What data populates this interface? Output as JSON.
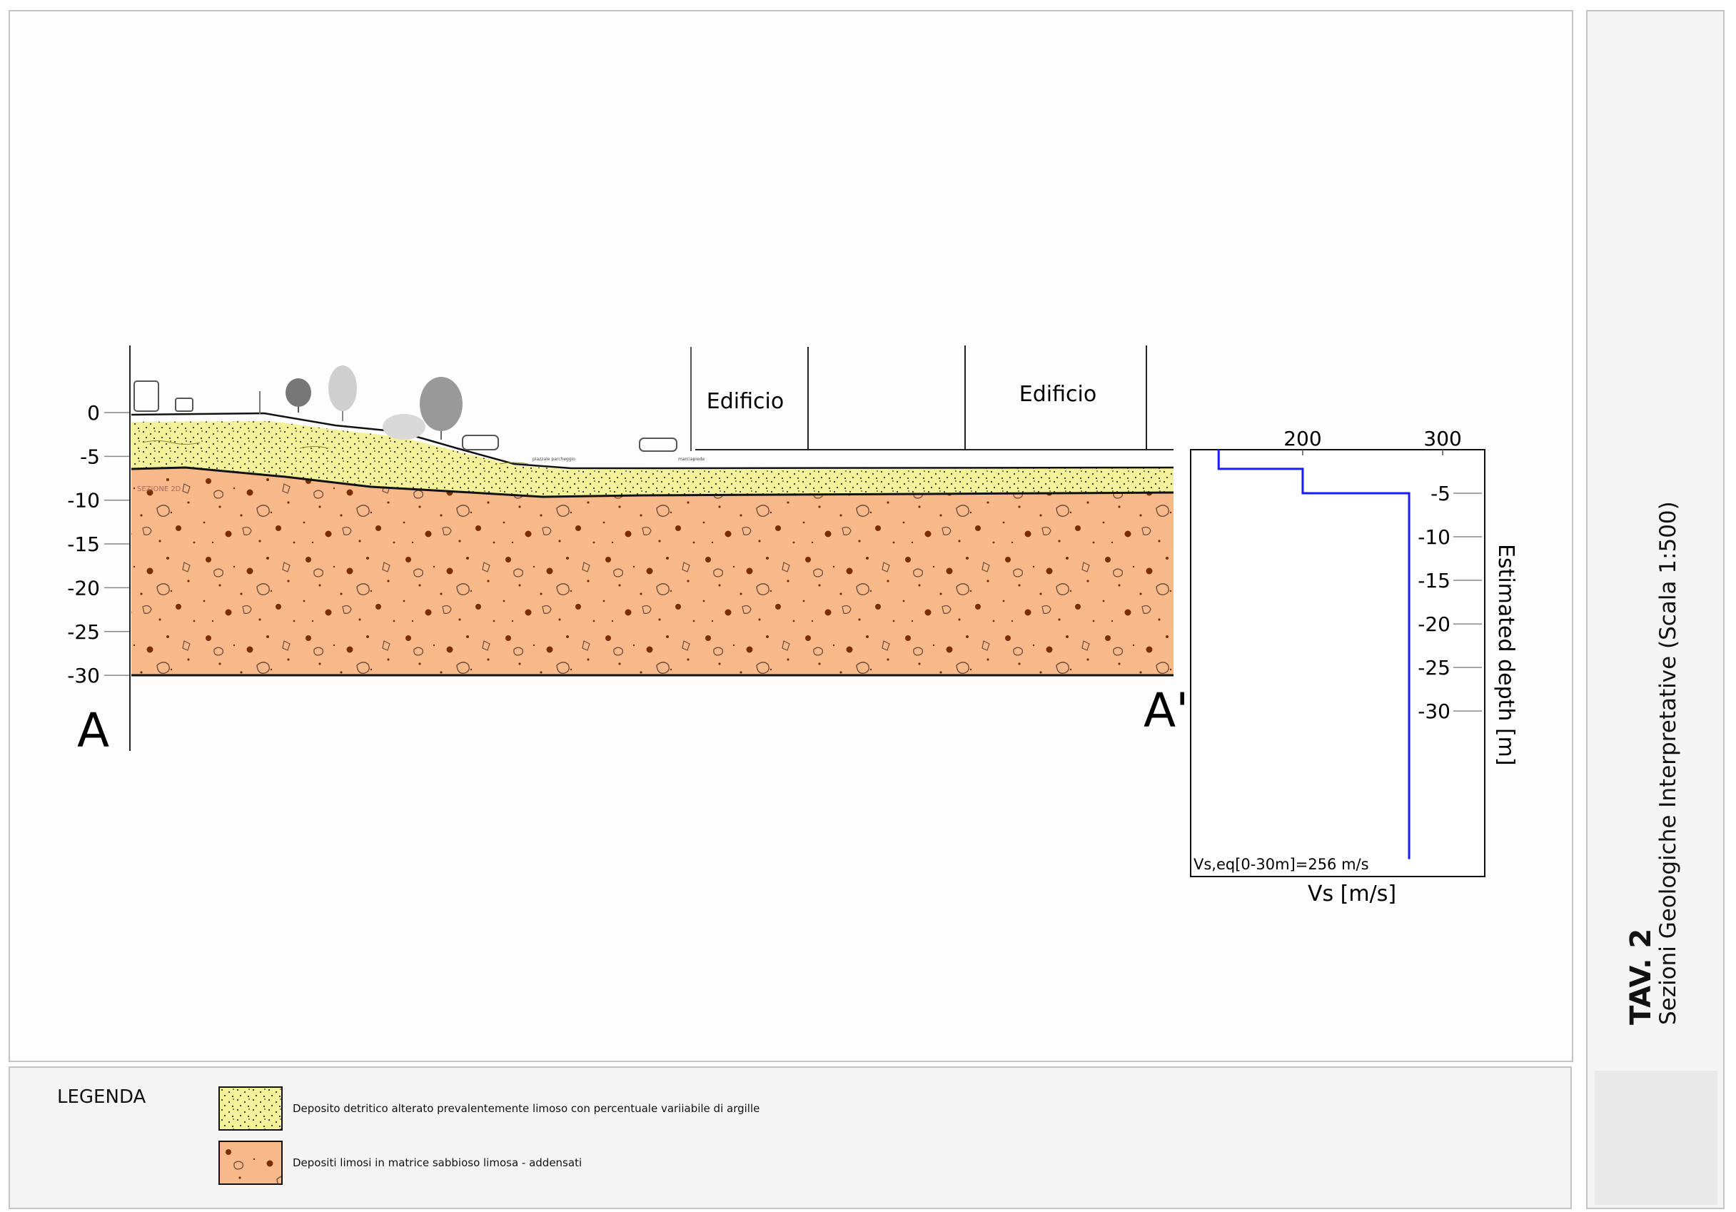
{
  "section": {
    "start_label": "A",
    "end_label": "A'",
    "depth_ticks": [
      "0",
      "-5",
      "-10",
      "-15",
      "-20",
      "-25",
      "-30"
    ],
    "buildings": [
      "Edificio",
      "Edificio"
    ],
    "ground_labels": [
      "piazzale parcheggio",
      "marciapiede"
    ],
    "small_label": "SEZIONE 2D"
  },
  "vs_profile": {
    "xlabel": "Vs [m/s]",
    "ylabel": "Estimated depth [m]",
    "xticks": [
      "200",
      "300"
    ],
    "yticks": [
      "-5",
      "-10",
      "-15",
      "-20",
      "-25",
      "-30"
    ],
    "annotation": "Vs,eq[0-30m]=256 m/s",
    "line_color": "#1a1aff"
  },
  "chart_data": {
    "type": "line",
    "title": "",
    "xlabel": "Vs [m/s]",
    "ylabel": "Estimated depth [m]",
    "xlim": [
      120,
      330
    ],
    "ylim": [
      0,
      -49
    ],
    "grid": false,
    "series": [
      {
        "values": [
          [
            140,
            0
          ],
          [
            140,
            -2.2
          ],
          [
            200,
            -2.2
          ],
          [
            200,
            -5
          ],
          [
            276,
            -5
          ],
          [
            276,
            -47
          ]
        ]
      }
    ]
  },
  "legend": {
    "title": "LEGENDA",
    "items": [
      {
        "label": "Deposito detritico alterato prevalentemente limoso con percentuale variiabile di argille",
        "color": "#f3f19a"
      },
      {
        "label": "Depositi limosi in matrice sabbioso limosa - addensati",
        "color": "#f8b98a"
      }
    ]
  },
  "title_block": {
    "tav": "TAV. 2",
    "subtitle": "Sezioni Geologiche Interpretative (Scala 1:500)"
  },
  "colors": {
    "yellow_layer": "#f3f19a",
    "orange_layer": "#f8b98a",
    "dot_color": "#7a2e00"
  }
}
